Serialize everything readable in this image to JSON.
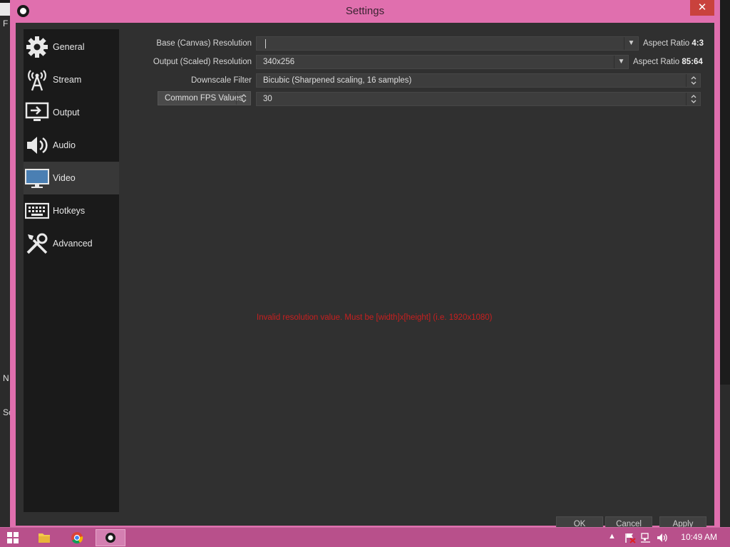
{
  "window": {
    "title": "Settings",
    "close_glyph": "✕"
  },
  "background": {
    "frag1": "F",
    "frag2": "N",
    "frag3": "Sc"
  },
  "sidebar": {
    "items": [
      {
        "label": "General",
        "icon": "gear-icon",
        "active": false
      },
      {
        "label": "Stream",
        "icon": "broadcast-icon",
        "active": false
      },
      {
        "label": "Output",
        "icon": "output-icon",
        "active": false
      },
      {
        "label": "Audio",
        "icon": "speaker-icon",
        "active": false
      },
      {
        "label": "Video",
        "icon": "monitor-icon",
        "active": true
      },
      {
        "label": "Hotkeys",
        "icon": "keyboard-icon",
        "active": false
      },
      {
        "label": "Advanced",
        "icon": "tools-icon",
        "active": false
      }
    ]
  },
  "video": {
    "base_label": "Base (Canvas) Resolution",
    "base_value": "",
    "base_aspect_label": "Aspect Ratio",
    "base_aspect_value": "4:3",
    "output_label": "Output (Scaled) Resolution",
    "output_value": "340x256",
    "output_aspect_label": "Aspect Ratio",
    "output_aspect_value": "85:64",
    "downscale_label": "Downscale Filter",
    "downscale_value": "Bicubic (Sharpened scaling, 16 samples)",
    "fps_type": "Common FPS Values",
    "fps_value": "30",
    "error": "Invalid resolution value. Must be [width]x[height] (i.e. 1920x1080)"
  },
  "buttons": {
    "ok": "OK",
    "cancel": "Cancel",
    "apply": "Apply"
  },
  "taskbar": {
    "time": "10:49 AM",
    "tray_up": "▲"
  },
  "colors": {
    "accent": "#e06fae",
    "error": "#c81f1f",
    "panel": "#303030",
    "sidebar": "#1a1a1a"
  }
}
